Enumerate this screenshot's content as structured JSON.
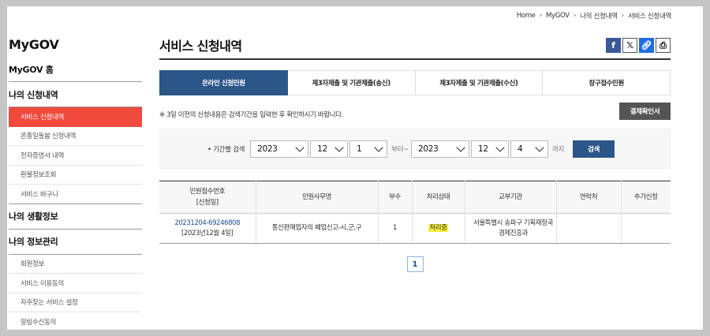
{
  "breadcrumb": [
    "Home",
    "MyGOV",
    "나의 신청내역",
    "서비스 신청내역"
  ],
  "sidebar": {
    "title": "MyGOV",
    "sections": [
      {
        "label": "MyGOV 홈",
        "items": []
      },
      {
        "label": "나의 신청내역",
        "items": [
          "서비스 신청내역",
          "온종일돌봄 신청내역",
          "전자증명서 내역",
          "환불정보조회",
          "서비스 바구니"
        ]
      },
      {
        "label": "나의 생활정보",
        "items": []
      },
      {
        "label": "나의 정보관리",
        "items": [
          "회원정보",
          "서비스 이용동의",
          "자주찾는 서비스 설정",
          "알림수신동의"
        ]
      }
    ],
    "active_item": "서비스 신청내역"
  },
  "main": {
    "title": "서비스 신청내역",
    "share_icons": [
      "facebook-icon",
      "twitter-x-icon",
      "link-icon",
      "print-icon"
    ],
    "tabs": [
      "온라인 신청민원",
      "제3자제출 및 기관제출(송신)",
      "제3자제출 및 기관제출(수신)",
      "창구접수민원"
    ],
    "active_tab": 0,
    "notice": "※ 3일 이전의 신청내용은 검색기간을 입력한 후 확인하시기 바랍니다.",
    "confirm_button": "결제확인서",
    "search": {
      "label": "• 기간별 검색",
      "from": {
        "year": "2023",
        "month": "12",
        "day": "1"
      },
      "from_suffix": "부터~",
      "to": {
        "year": "2023",
        "month": "12",
        "day": "4"
      },
      "to_suffix": "까지",
      "button": "검색"
    },
    "table": {
      "headers": [
        "민원접수번호\n[신청일]",
        "민원사무명",
        "부수",
        "처리상태",
        "교부기관",
        "연락처",
        "추가신청"
      ],
      "rows": [
        {
          "receipt_no": "20231204-69246808",
          "date": "[2023년12월 4일]",
          "name": "통신판매업자의 폐업신고-시,군,구",
          "copies": "1",
          "status": "처리중",
          "agency": "서울특별시 송파구 기획재정국 경제진흥과",
          "contact": "",
          "extra": ""
        }
      ]
    },
    "pager": [
      "1"
    ]
  },
  "colors": {
    "accent": "#2c5688",
    "active_menu": "#f04a3c",
    "highlight": "#f3ef3a"
  }
}
